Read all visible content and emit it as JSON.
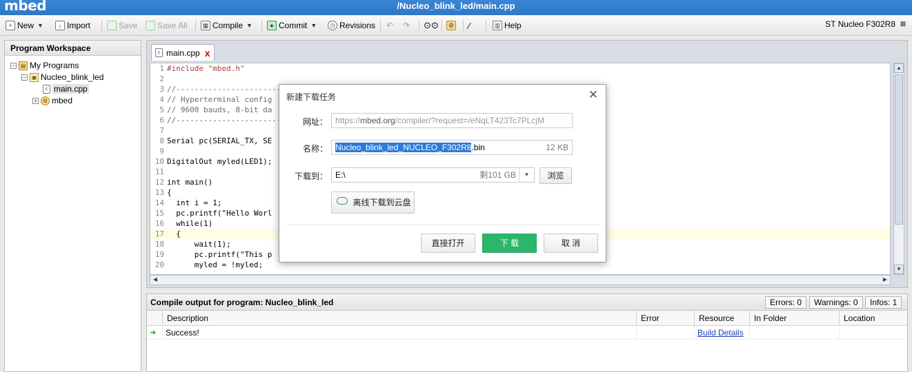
{
  "app": {
    "brand": "mbed",
    "doc_path": "/Nucleo_blink_led/main.cpp"
  },
  "toolbar": {
    "new_label": "New",
    "import_label": "Import",
    "save_label": "Save",
    "save_all_label": "Save All",
    "compile_label": "Compile",
    "commit_label": "Commit",
    "revisions_label": "Revisions",
    "help_label": "Help",
    "board_label": "ST Nucleo F302R8"
  },
  "workspace": {
    "title": "Program Workspace",
    "tree": {
      "root": "My Programs",
      "program": "Nucleo_blink_led",
      "file": "main.cpp",
      "library": "mbed"
    }
  },
  "editor": {
    "tab_label": "main.cpp",
    "tab_close": "x",
    "highlighted_line": 17,
    "lines": [
      {
        "n": "1",
        "text": "#include \"mbed.h\""
      },
      {
        "n": "2",
        "text": ""
      },
      {
        "n": "3",
        "text": "//------------------------"
      },
      {
        "n": "4",
        "text": "// Hyperterminal config"
      },
      {
        "n": "5",
        "text": "// 9600 bauds, 8-bit da"
      },
      {
        "n": "6",
        "text": "//------------------------"
      },
      {
        "n": "7",
        "text": ""
      },
      {
        "n": "8",
        "text": "Serial pc(SERIAL_TX, SE"
      },
      {
        "n": "9",
        "text": ""
      },
      {
        "n": "10",
        "text": "DigitalOut myled(LED1);"
      },
      {
        "n": "11",
        "text": ""
      },
      {
        "n": "12",
        "text": "int main()"
      },
      {
        "n": "13",
        "text": "{"
      },
      {
        "n": "14",
        "text": "  int i = 1;"
      },
      {
        "n": "15",
        "text": "  pc.printf(\"Hello Worl"
      },
      {
        "n": "16",
        "text": "  while(1)"
      },
      {
        "n": "17",
        "text": "  {"
      },
      {
        "n": "18",
        "text": "      wait(1);"
      },
      {
        "n": "19",
        "text": "      pc.printf(\"This p"
      },
      {
        "n": "20",
        "text": "      myled = !myled;"
      }
    ]
  },
  "output": {
    "title": "Compile output for program: Nucleo_blink_led",
    "errors": "Errors: 0",
    "warnings": "Warnings: 0",
    "infos": "Infos: 1",
    "columns": [
      "Description",
      "Error",
      "Resource",
      "In Folder",
      "Location"
    ],
    "rows": [
      {
        "description": "Success!",
        "error": "",
        "resource": "Build Details",
        "folder": "",
        "location": ""
      }
    ]
  },
  "dialog": {
    "title": "新建下载任务",
    "url_label": "网址：",
    "url_prefix": "https://",
    "url_domain": "mbed.org",
    "url_rest": "/compiler/?request=/eNqLT423Tc7PLcjM",
    "name_label": "名称：",
    "name_selected": "Nucleo_blink_led_NUCLEO_F302R8",
    "name_ext": ".bin",
    "name_size": "12 KB",
    "path_label": "下载到：",
    "path_value": "E:\\",
    "path_free": "剩101 GB",
    "browse_label": "浏览",
    "cloud_label": "离线下载到云盘",
    "open_label": "直接打开",
    "download_label": "下 载",
    "cancel_label": "取 消"
  }
}
